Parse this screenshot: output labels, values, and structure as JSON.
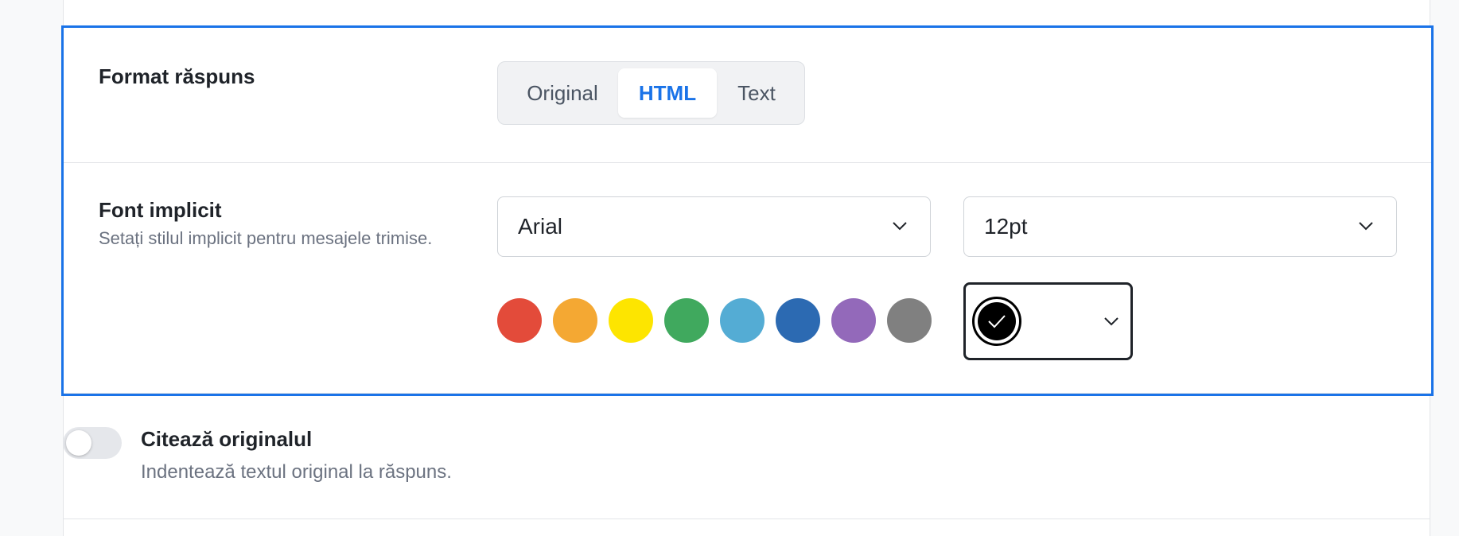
{
  "reply_format": {
    "title": "Format răspuns",
    "options": [
      {
        "label": "Original",
        "active": false
      },
      {
        "label": "HTML",
        "active": true
      },
      {
        "label": "Text",
        "active": false
      }
    ]
  },
  "default_font": {
    "title": "Font implicit",
    "description": "Setați stilul implicit pentru mesajele trimise.",
    "font_family": "Arial",
    "font_size": "12pt",
    "swatches": [
      {
        "name": "red",
        "color": "#e34b3a"
      },
      {
        "name": "orange",
        "color": "#f4a833"
      },
      {
        "name": "yellow",
        "color": "#fde500"
      },
      {
        "name": "green",
        "color": "#40a95e"
      },
      {
        "name": "light-blue",
        "color": "#54acd4"
      },
      {
        "name": "blue",
        "color": "#2c6ab2"
      },
      {
        "name": "purple",
        "color": "#9369ba"
      },
      {
        "name": "gray",
        "color": "#808080"
      }
    ],
    "selected_color": "#000000"
  },
  "quote_original": {
    "title": "Citează originalul",
    "description": "Indentează textul original la răspuns.",
    "enabled": false
  },
  "colors": {
    "accent": "#1a73e8"
  }
}
